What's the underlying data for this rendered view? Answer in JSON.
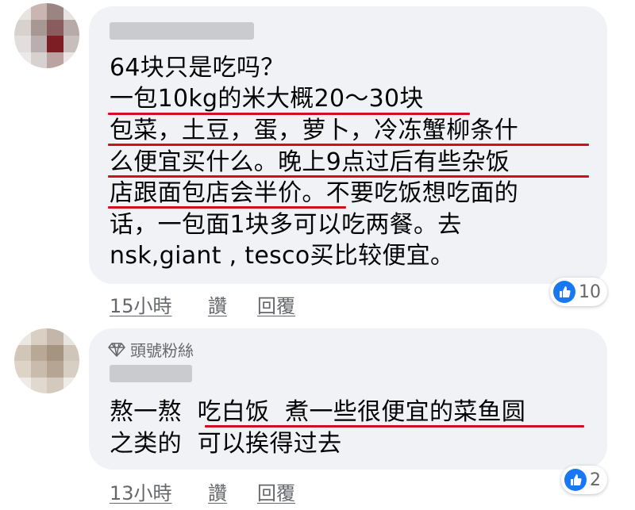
{
  "comments": [
    {
      "lines": [
        "64块只是吃吗？",
        "一包10kg的米大概20～30块",
        "包菜，土豆，蛋，萝卜，冷冻蟹柳条什",
        "么便宜买什么。晚上9点过后有些杂饭",
        "店跟面包店会半价。不要吃饭想吃面的",
        "话，一包面1块多可以吃两餐。去",
        "nsk,giant , tesco买比较便宜。"
      ],
      "time": "15小時",
      "like_label": "讚",
      "reply_label": "回覆",
      "reaction_count": "10"
    },
    {
      "badge": "頭號粉絲",
      "lines": [
        "熬一熬  吃白饭  煮一些很便宜的菜鱼圆",
        "之类的  可以挨得过去"
      ],
      "time": "13小時",
      "like_label": "讚",
      "reply_label": "回覆",
      "reaction_count": "2"
    }
  ],
  "colors": {
    "bubble": "#f0f2f5",
    "underline": "#d20f1e",
    "like_blue": "#1877f2",
    "meta_gray": "#65676b"
  }
}
